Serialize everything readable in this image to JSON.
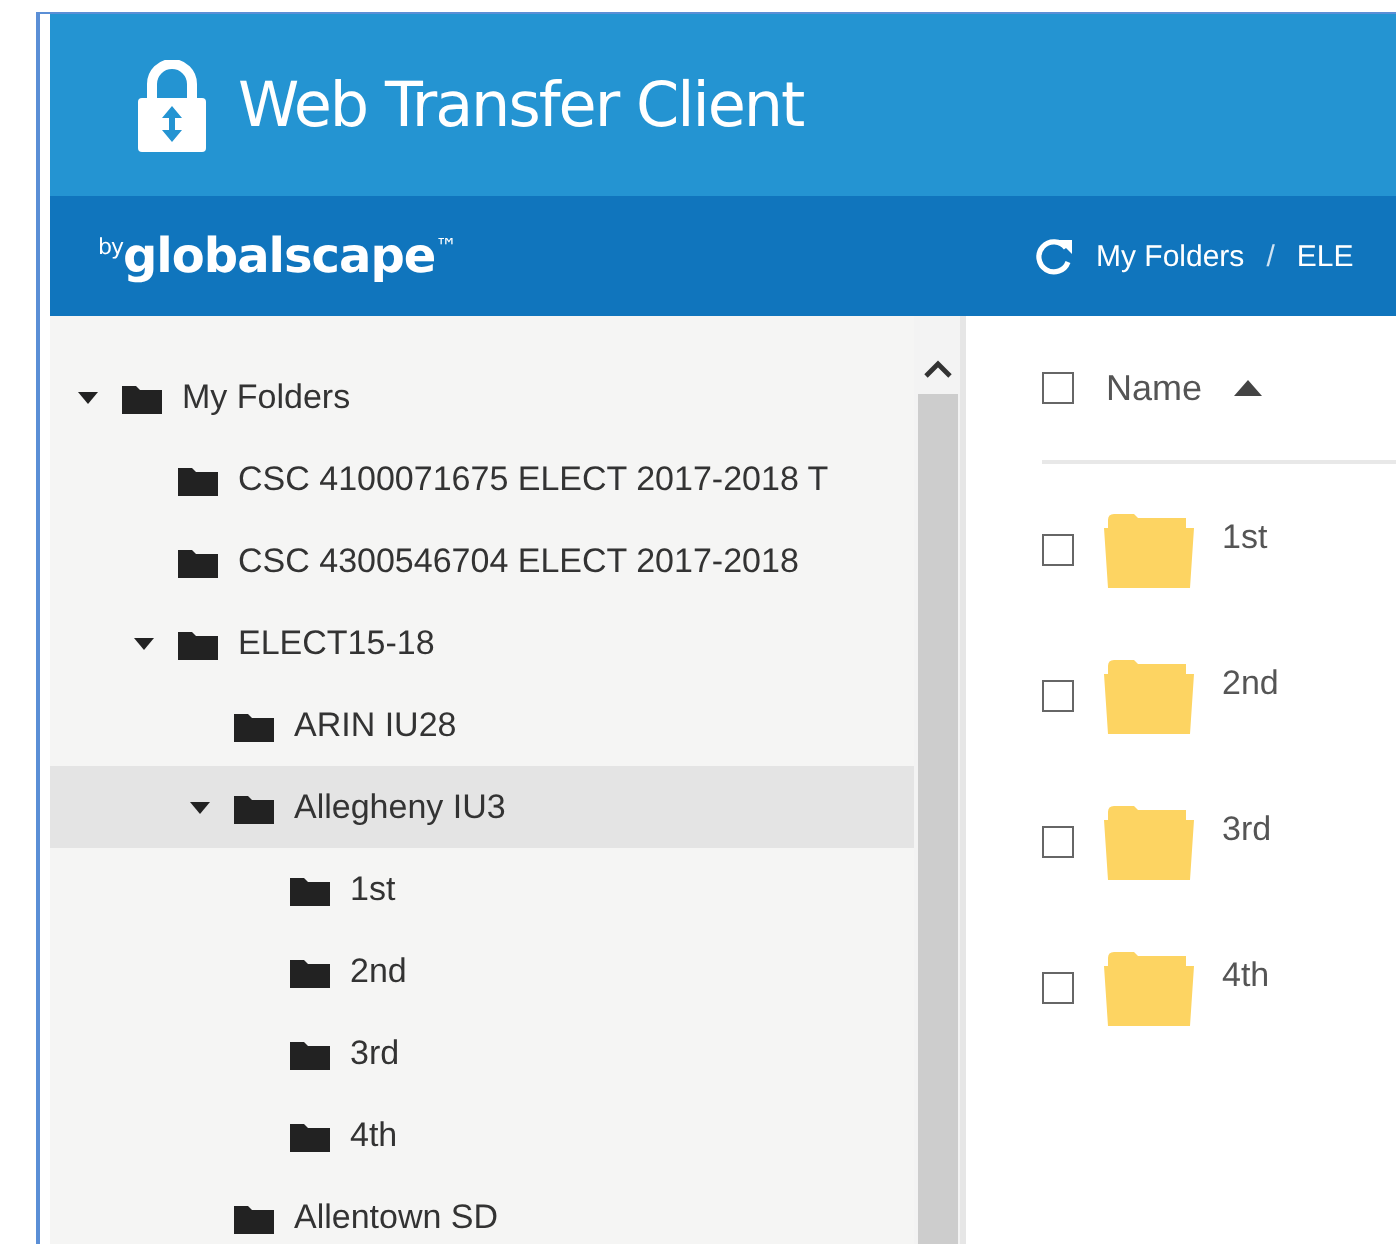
{
  "header": {
    "title": "Web Transfer Client",
    "brand": "$^{by}$globalscape$^{™}$"
  },
  "breadcrumb": [
    "My Folders",
    "/",
    "ELE"
  ],
  "tree": [
    {
      "label": "My Folders",
      "expanded": true,
      "selected": false,
      "children": [
        {
          "label": "CSC 4100071675 ELECT 2017-2018 T",
          "selected": false
        },
        {
          "label": "CSC 4300546704 ELECT 2017-2018",
          "selected": false
        },
        {
          "label": "ELECT15-18",
          "expanded": true,
          "selected": false,
          "children": [
            {
              "label": "ARIN IU28",
              "selected": false
            },
            {
              "label": "Allegheny IU3",
              "expanded": true,
              "selected": true,
              "children": [
                {
                  "label": "1st",
                  "selected": false
                },
                {
                  "label": "2nd",
                  "selected": false
                },
                {
                  "label": "3rd",
                  "selected": false
                },
                {
                  "label": "4th",
                  "selected": false
                }
              ]
            },
            {
              "label": "Allentown SD",
              "selected": false
            }
          ]
        }
      ]
    }
  ],
  "list": {
    "header": {
      "label": "Name",
      "checked": false
    },
    "rows": [
      {
        "name": "1st",
        "checked": false
      },
      {
        "name": "2nd",
        "checked": false
      },
      {
        "name": "3rd",
        "checked": false
      },
      {
        "name": "4th",
        "checked": false
      }
    ]
  }
}
